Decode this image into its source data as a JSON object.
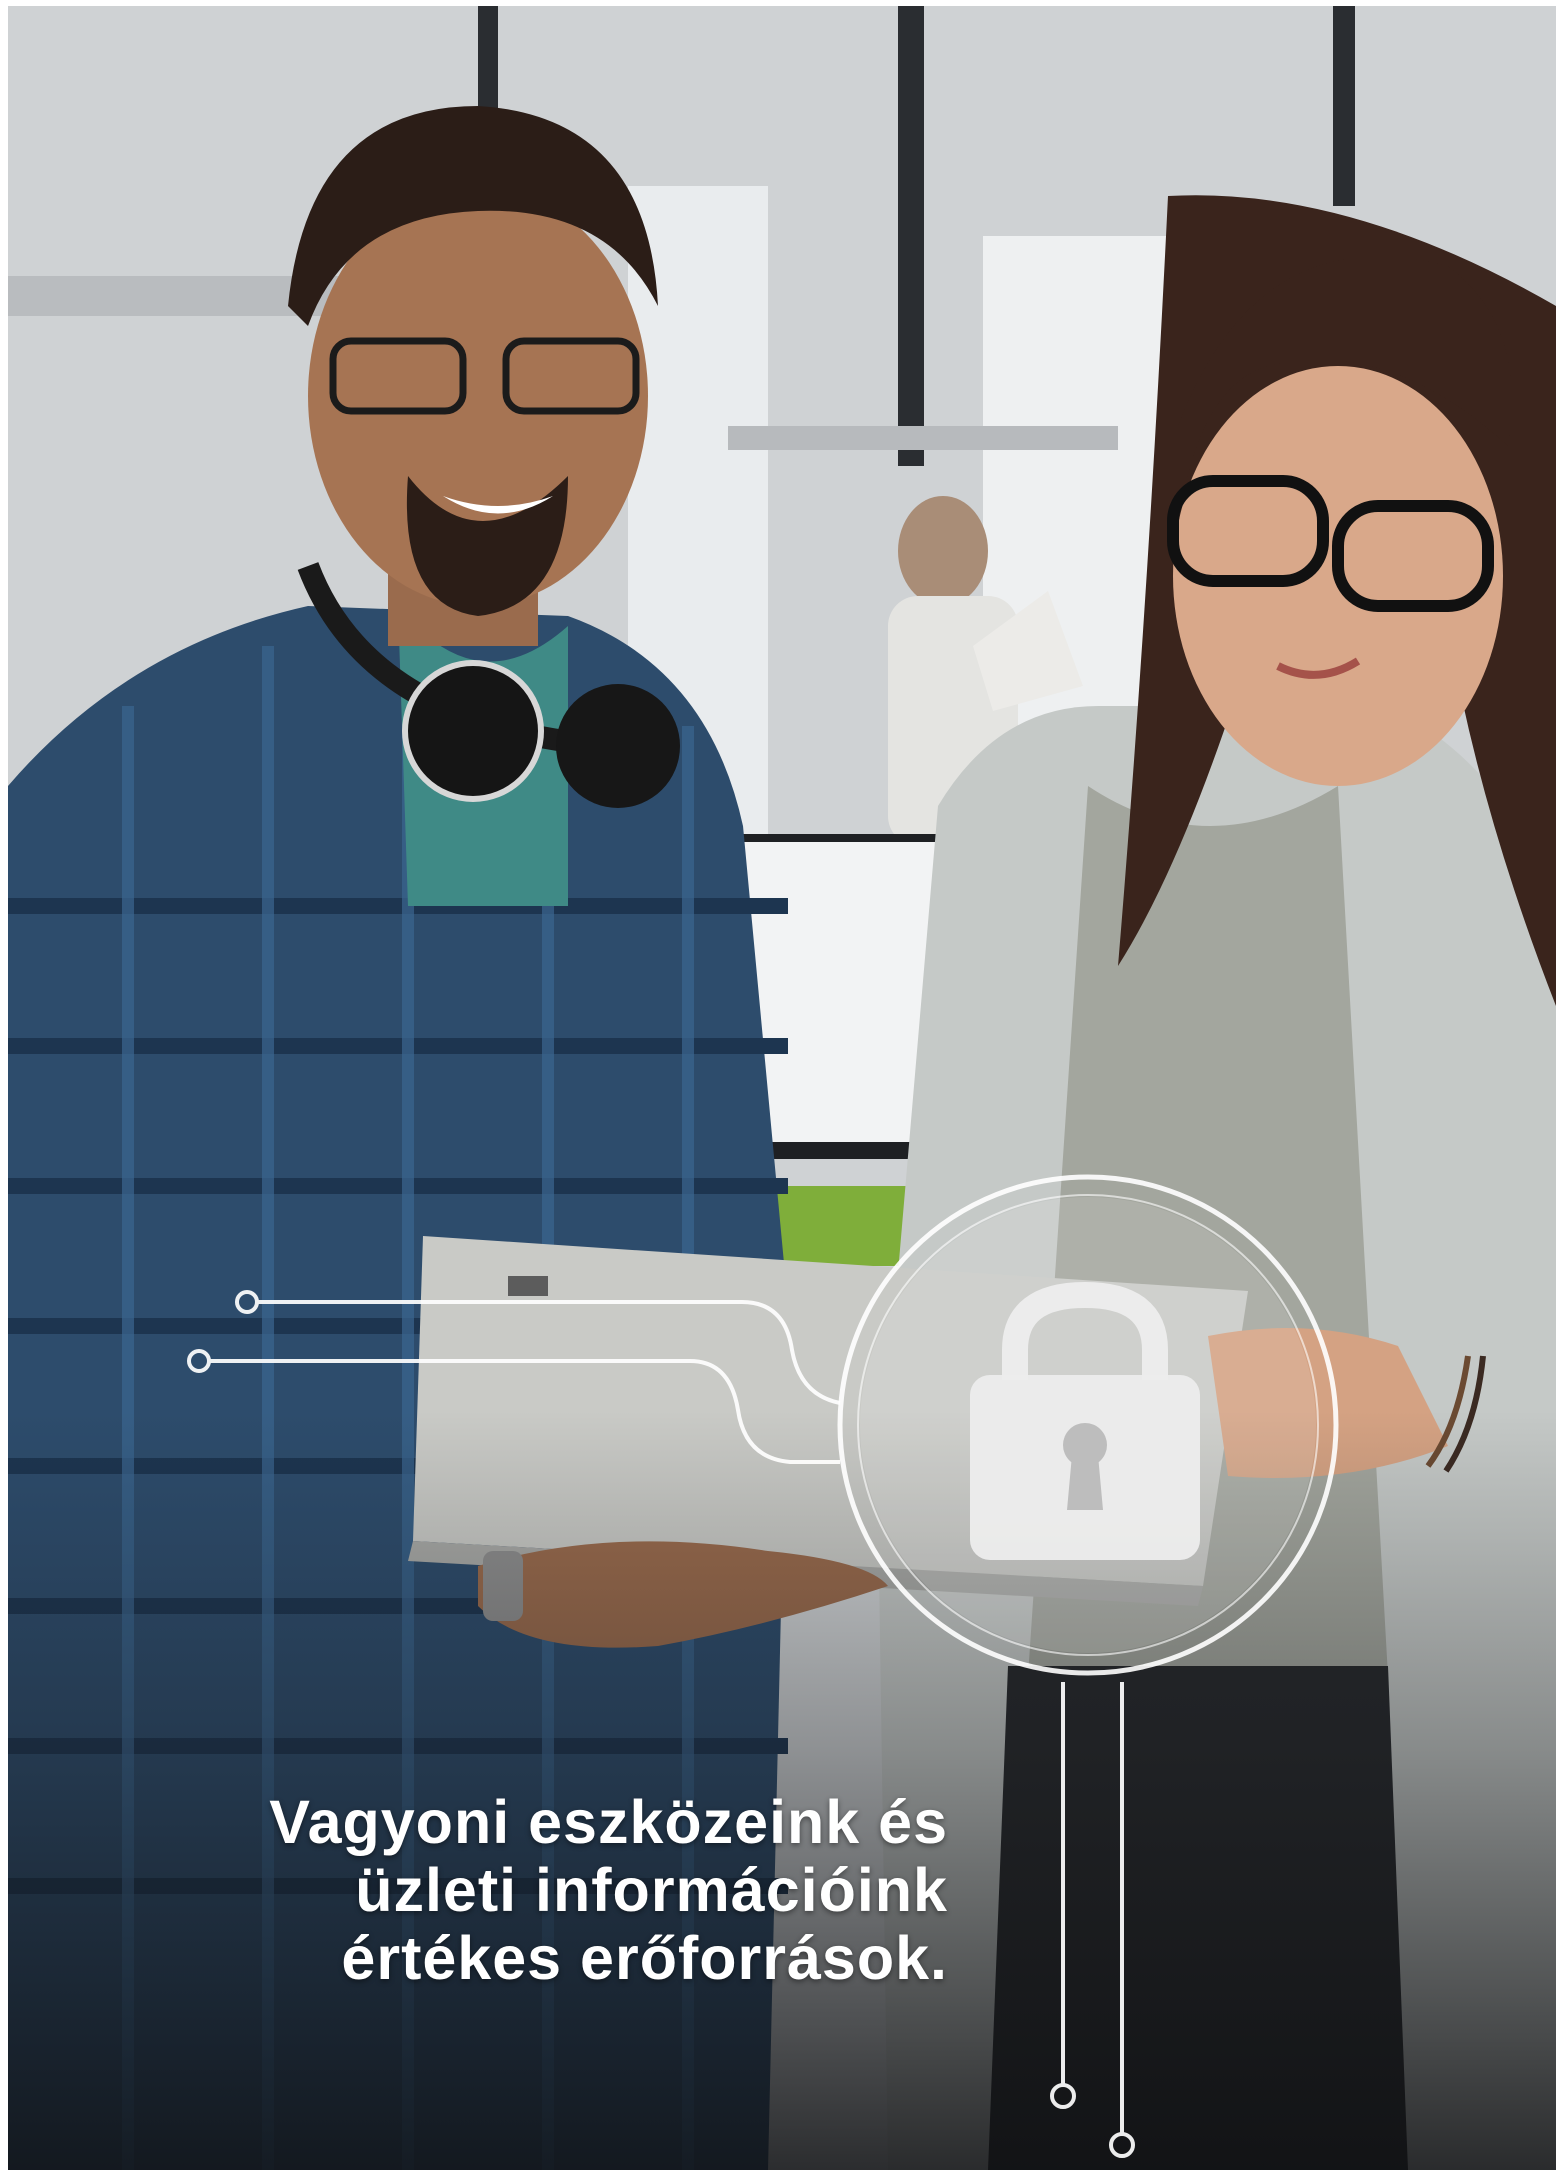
{
  "headline": {
    "lines": [
      "Vagyoni eszközeink és",
      "üzleti információink",
      "értékes erőforrások."
    ]
  },
  "icons": {
    "lock": "padlock-icon",
    "circuit": "circuit-lines-icon"
  },
  "colors": {
    "text": "#ffffff",
    "shirt": "#2c4a6b",
    "blazer": "#c8cbc9",
    "lock": "#ececec"
  }
}
